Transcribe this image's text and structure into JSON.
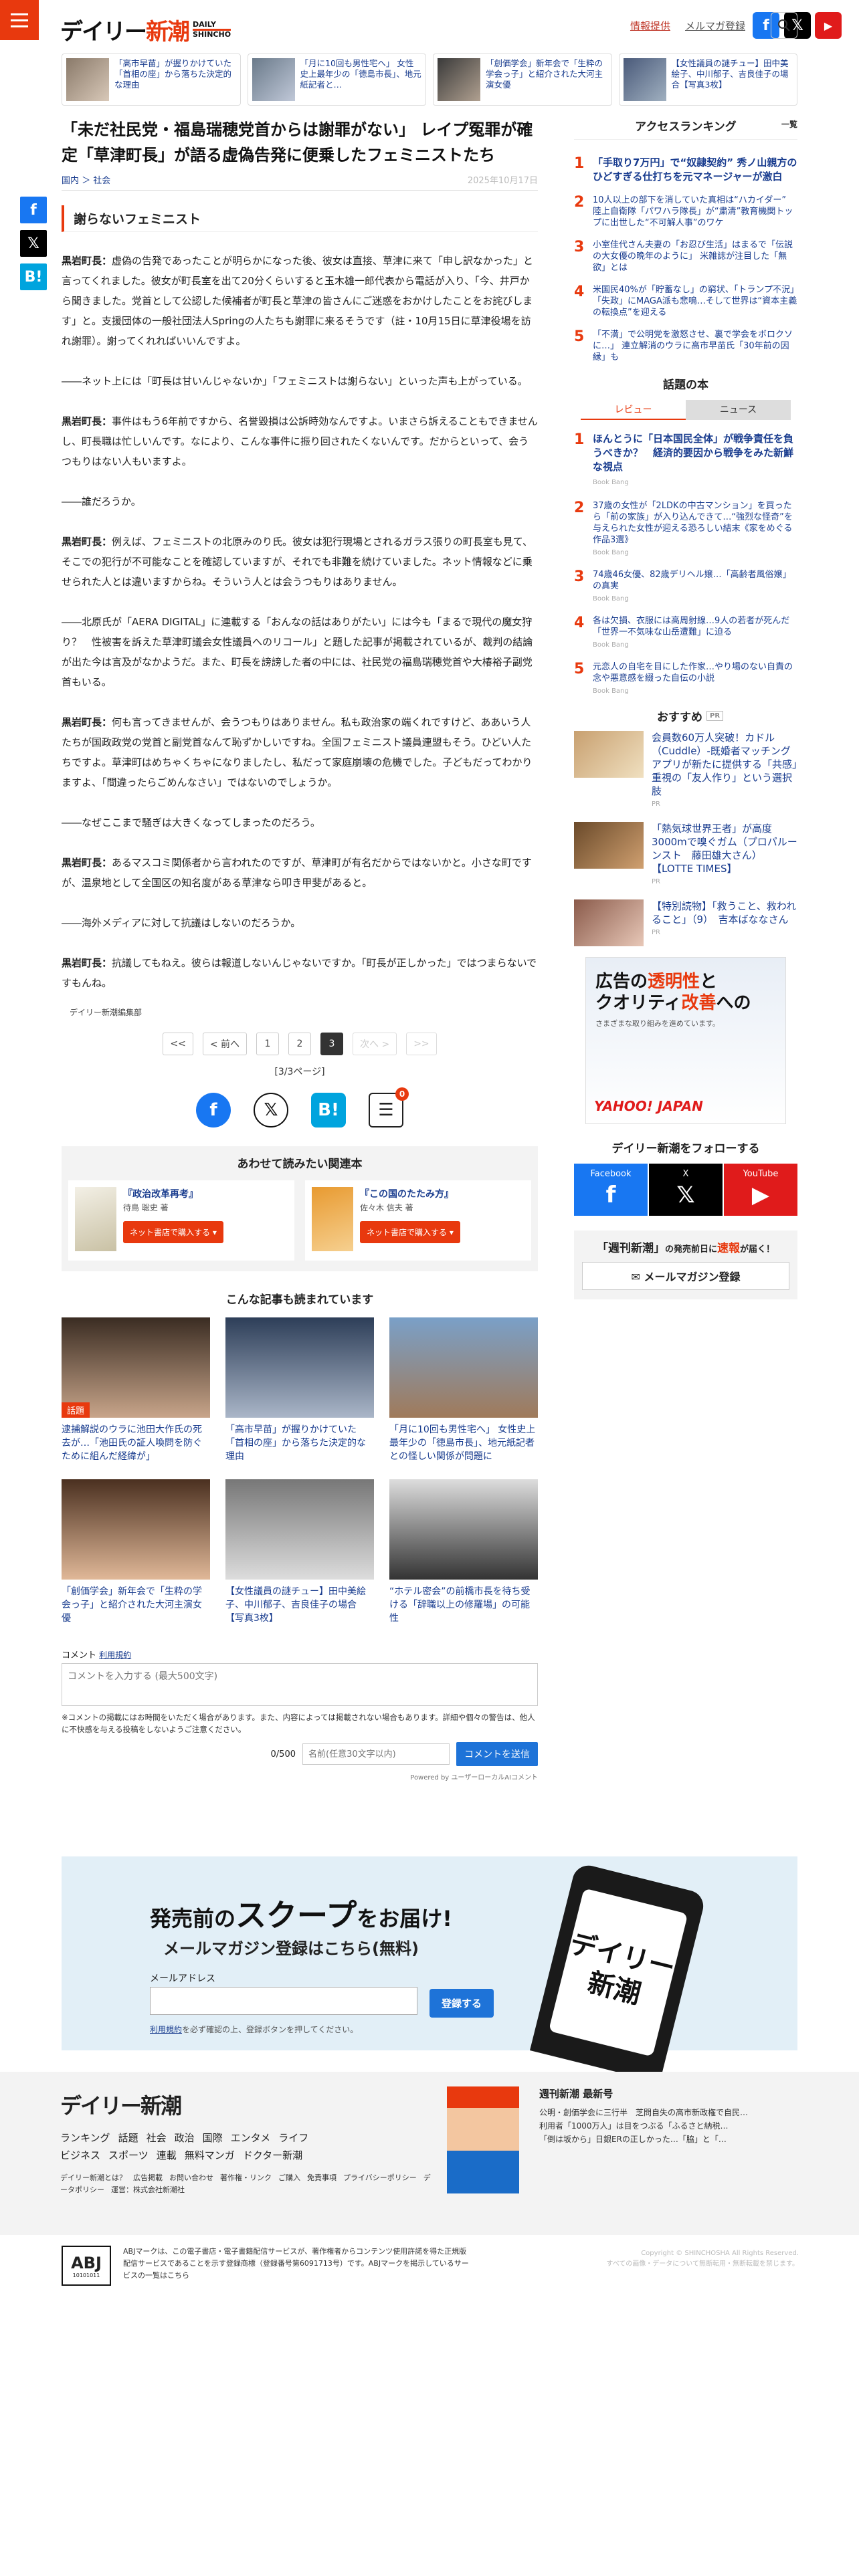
{
  "header": {
    "logo_jp_a": "デイリー",
    "logo_jp_b": "新潮",
    "logo_en_1": "DAILY",
    "logo_en_2": "SHINCHO",
    "tip_link": "情報提供",
    "mailmag_link": "メルマガ登録"
  },
  "top_cards": [
    {
      "title": "「高市早苗」が握りかけていた「首相の座」から落ちた決定的な理由"
    },
    {
      "title": "「月に10回も男性宅へ」 女性史上最年少の「徳島市長」、地元紙記者と…"
    },
    {
      "title": "「創価学会」新年会で「生粋の学会っ子」と紹介された大河主演女優"
    },
    {
      "title": "【女性議員の謎チュー】田中美絵子、中川郁子、吉良佳子の場合【写真3枚】"
    }
  ],
  "article": {
    "title": "「未だ社民党・福島瑞穂党首からは謝罪がない」 レイプ冤罪が確定「草津町長」が語る虚偽告発に便乗したフェミニストたち",
    "crumb_1": "国内",
    "crumb_2": "社会",
    "date": "2025年10月17日",
    "section": "謝らないフェミニスト",
    "paras": [
      {
        "sp": "黒岩町長：",
        "tx": "虚偽の告発であったことが明らかになった後、彼女は直接、草津に来て「申し訳なかった」と言ってくれました。彼女が町長室を出て20分くらいすると玉木雄一郎代表から電話が入り、「今、井戸から聞きました。党首として公認した候補者が町長と草津の皆さんにご迷惑をおかけしたことをお詫びします」と。支援団体の一般社団法人Springの人たちも謝罪に来るそうです（註・10月15日に草津役場を訪れ謝罪）。謝ってくれればいいんですよ。"
      },
      {
        "sp": "",
        "tx": "――ネット上には「町長は甘いんじゃないか」「フェミニストは謝らない」といった声も上がっている。"
      },
      {
        "sp": "黒岩町長：",
        "tx": "事件はもう6年前ですから、名誉毀損は公訴時効なんですよ。いまさら訴えることもできませんし、町長職は忙しいんです。なにより、こんな事件に振り回されたくないんです。だからといって、会うつもりはない人もいますよ。"
      },
      {
        "sp": "",
        "tx": "――誰だろうか。"
      },
      {
        "sp": "黒岩町長：",
        "tx": "例えば、フェミニストの北原みのり氏。彼女は犯行現場とされるガラス張りの町長室も見て、そこでの犯行が不可能なことを確認していますが、それでも非難を続けていました。ネット情報などに乗せられた人とは違いますからね。そういう人とは会うつもりはありません。"
      },
      {
        "sp": "",
        "tx": "――北原氏が「AERA DIGITAL」に連載する「おんなの話はありがたい」には今も「まるで現代の魔女狩り？　性被害を訴えた草津町議会女性議員へのリコール」と題した記事が掲載されているが、裁判の結論が出た今は言及がなかようだ。また、町長を謗謗した者の中には、社民党の福島瑞穂党首や大椿裕子副党首もいる。"
      },
      {
        "sp": "黒岩町長：",
        "tx": "何も言ってきませんが、会うつもりはありません。私も政治家の端くれですけど、ああいう人たちが国政政党の党首と副党首なんて恥ずかしいですね。全国フェミニスト議員連盟もそう。ひどい人たちですよ。草津町はめちゃくちゃになりましたし、私だって家庭崩壊の危機でした。子どもだってわかりますよ、「間違ったらごめんなさい」ではないのでしょうか。"
      },
      {
        "sp": "",
        "tx": "――なぜここまで騒ぎは大きくなってしまったのだろう。"
      },
      {
        "sp": "黒岩町長：",
        "tx": "あるマスコミ関係者から言われたのですが、草津町が有名だからではないかと。小さな町ですが、温泉地として全国区の知名度がある草津なら叩き甲斐があると。"
      },
      {
        "sp": "",
        "tx": "――海外メディアに対して抗議はしないのだろうか。"
      },
      {
        "sp": "黒岩町長：",
        "tx": "抗議してもねえ。彼らは報道しないんじゃないですか。「町長が正しかった」ではつまらないですもんね。"
      }
    ],
    "credit": "デイリー新潮編集部",
    "pager": {
      "first": "<<",
      "prev": "< 前へ",
      "p1": "1",
      "p2": "2",
      "p3": "3",
      "next": "次へ >",
      "last": ">>",
      "info": "[3/3ページ]"
    },
    "comment_badge": "0"
  },
  "related": {
    "heading": "あわせて読みたい関連本",
    "books": [
      {
        "title": "『政治改革再考』",
        "author": "待鳥 聡史 著",
        "btn": "ネット書店で購入する ▾"
      },
      {
        "title": "『この国のたたみ方』",
        "author": "佐々木 信夫 著",
        "btn": "ネット書店で購入する ▾"
      }
    ]
  },
  "also": {
    "heading": "こんな記事も読まれています",
    "items": [
      {
        "cap": "逮捕解説のウラに池田大作氏の死去が…「池田氏の証人喚問を防ぐために組んだ経緯が」",
        "tag": "話題"
      },
      {
        "cap": "「高市早苗」が握りかけていた「首相の座」から落ちた決定的な理由",
        "tag": ""
      },
      {
        "cap": "「月に10回も男性宅へ」 女性史上最年少の「徳島市長」、地元紙記者との怪しい関係が問題に",
        "tag": ""
      },
      {
        "cap": "「創価学会」新年会で「生粋の学会っ子」と紹介された大河主演女優",
        "tag": ""
      },
      {
        "cap": "【女性議員の謎チュー】田中美絵子、中川郁子、吉良佳子の場合【写真3枚】",
        "tag": ""
      },
      {
        "cap": "“ホテル密会”の前橋市長を待ち受ける「辞職以上の修羅場」の可能性",
        "tag": ""
      }
    ]
  },
  "comment": {
    "label": "コメント",
    "terms": "利用規約",
    "placeholder": "コメントを入力する (最大500文字)",
    "note": "※コメントの掲載にはお時間をいただく場合があります。また、内容によっては掲載されない場合もあります。詳細や個々の警告は、他人に不快感を与える投稿をしないようご注意ください。",
    "count": "0/500",
    "name_placeholder": "名前(任意30文字以内)",
    "send": "コメントを送信",
    "powered": "Powered by ユーザーローカルAIコメント"
  },
  "ranking": {
    "heading": "アクセスランキング",
    "more": "一覧",
    "items": [
      "「手取り7万円」で“奴隷契約” 秀ノ山親方のひどすぎる仕打ちを元マネージャーが激白",
      "10人以上の部下を消していた真相は“ハカイダー” 陸上自衛隊「パワハラ隊長」が“粛清”教育機関トップに出世した“不可解人事”のワケ",
      "小室佳代さん夫妻の「お忍び生活」はまるで「伝説の大女優の晩年のように」 米雑誌が注目した「無欲」とは",
      "米国民40%が「貯蓄なし」の窮状、「トランプ不況」「失政」にMAGA派も悲鳴…そして世界は“資本主義の転換点”を迎える",
      "「不満」で公明党を激怒させ、裏で学会をボロクソに…」 連立解消のウラに高市早苗氏「30年前の因縁」も"
    ]
  },
  "bookrank": {
    "heading": "話題の本",
    "tab_review": "レビュー",
    "tab_news": "ニュース",
    "items": [
      {
        "t": "ほんとうに「日本国民全体」が戦争責任を負うべきか？　経済的要因から戦争をみた新鮮な視点",
        "s": "Book Bang"
      },
      {
        "t": "37歳の女性が「2LDKの中古マンション」を買ったら「前の家族」が入り込んできて…“強烈な怪奇”を与えられた女性が迎える恐ろしい結末《家をめぐる作品3選》",
        "s": "Book Bang"
      },
      {
        "t": "74歳46女優、82歳デリヘル嬢…「高齢者風俗嬢」の真実",
        "s": "Book Bang"
      },
      {
        "t": "各は欠損、衣服には高周射線…9人の若者が死んだ「世界一不気味な山岳遭難」に迫る",
        "s": "Book Bang"
      },
      {
        "t": "元恋人の自宅を目にした作家…やり場のない自責の念や悪意感を綴った自伝の小説",
        "s": "Book Bang"
      }
    ]
  },
  "recommend": {
    "heading": "おすすめ",
    "pr": "PR",
    "items": [
      {
        "t": "会員数60万人突破！カドル（Cuddle）-既婚者マッチングアプリが新たに提供する「共感」重視の「友人作り」という選択肢",
        "s": "PR"
      },
      {
        "t": "「熱気球世界王者」が高度3000mで嗅ぐガム（プロパルーンスト　藤田雄大さん）【LOTTE TIMES】",
        "s": "PR"
      },
      {
        "t": "【特別読物】「救うこと、救われること」（9）　吉本ばななさん",
        "s": "PR"
      }
    ]
  },
  "ad": {
    "line1a": "広告の",
    "line1b": "透明性",
    "line1c": "と",
    "line2a": "クオリティ",
    "line2b": "改善",
    "line2c": "への",
    "sub": "さまざまな取り組みを進めています。",
    "brand": "YAHOO! JAPAN"
  },
  "follow": {
    "heading": "デイリー新潮をフォローする",
    "fb": "Facebook",
    "x": "X",
    "yt": "YouTube",
    "fb_ico": "f",
    "x_ico": "𝕏",
    "yt_ico": "▶"
  },
  "magbox": {
    "line_a": "「週刊新潮」",
    "line_b": "の発売前日に",
    "line_c": "速報",
    "line_d": "が届く！",
    "btn": "✉ メールマガジン登録"
  },
  "promo": {
    "title_a": "発売前の",
    "title_b": "スクープ",
    "title_c": "をお届け!",
    "sub": "メールマガジン登録はこちら(無料)",
    "mail_label": "メールアドレス",
    "btn": "登録する",
    "note_a": "利用規約",
    "note_b": "を必ず確認の上、登録ボタンを押してください。",
    "phone": "デイリー新潮"
  },
  "footer": {
    "logo": "デイリー新潮",
    "links": [
      "ランキング",
      "話題",
      "社会",
      "政治",
      "国際",
      "エンタメ",
      "ライフ",
      "ビジネス",
      "スポーツ",
      "連載",
      "無料マンガ",
      "ドクター新潮"
    ],
    "small": [
      "デイリー新潮とは？",
      "広告掲載",
      "お問い合わせ",
      "著作権・リンク",
      "ご購入",
      "免責事項",
      "プライバシーポリシー",
      "データポリシー",
      "運営：株式会社新潮社"
    ],
    "news_head": "週刊新潮 最新号",
    "news": [
      "公明・創価学会に三行半　芝問自失の高市新政権で自民…",
      "利用者「1000万人」は目をつぶる「ふるさと納税…",
      "「倒は坂から」日銀ERの正しかった…「脇」と「…"
    ]
  },
  "copyright": {
    "abj": "ABJ",
    "abj_no": "10101011",
    "text": "ABJマークは、この電子書店・電子書籍配信サービスが、著作権者からコンテンツ使用許諾を得た正規版配信サービスであることを示す登録商標（登録番号第6091713号）です。ABJマークを掲示しているサービスの一覧はこちら",
    "r1": "Copyright © SHINCHOSHA All Rights Reserved.",
    "r2": "すべての画像・データについて無断転用・無断転載を禁じます。"
  }
}
